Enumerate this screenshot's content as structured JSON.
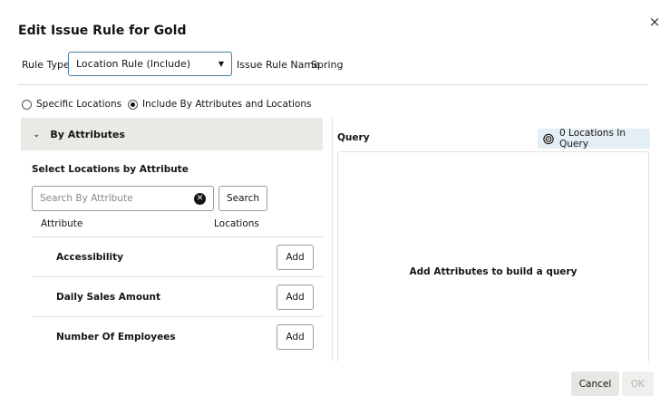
{
  "dialog": {
    "title": "Edit Issue Rule for Gold",
    "close_label": "×"
  },
  "rule": {
    "type_label": "Rule Type",
    "type_value": "Location Rule (Include)",
    "name_label": "Issue Rule Name",
    "name_value": "Spring"
  },
  "radios": [
    {
      "label": "Specific Locations",
      "checked": false
    },
    {
      "label": "Include By Attributes and Locations",
      "checked": true
    }
  ],
  "attributes_panel": {
    "header": "By Attributes",
    "section_title": "Select Locations by Attribute",
    "search_placeholder": "Search By Attribute",
    "search_button": "Search",
    "col_attribute": "Attribute",
    "col_locations": "Locations",
    "rows": [
      {
        "name": "Accessibility",
        "action": "Add"
      },
      {
        "name": "Daily Sales Amount",
        "action": "Add"
      },
      {
        "name": "Number Of Employees",
        "action": "Add"
      }
    ]
  },
  "query_panel": {
    "label": "Query",
    "badge": "0 Locations In Query",
    "empty_message": "Add Attributes to build a query"
  },
  "footer": {
    "cancel": "Cancel",
    "ok": "OK"
  }
}
